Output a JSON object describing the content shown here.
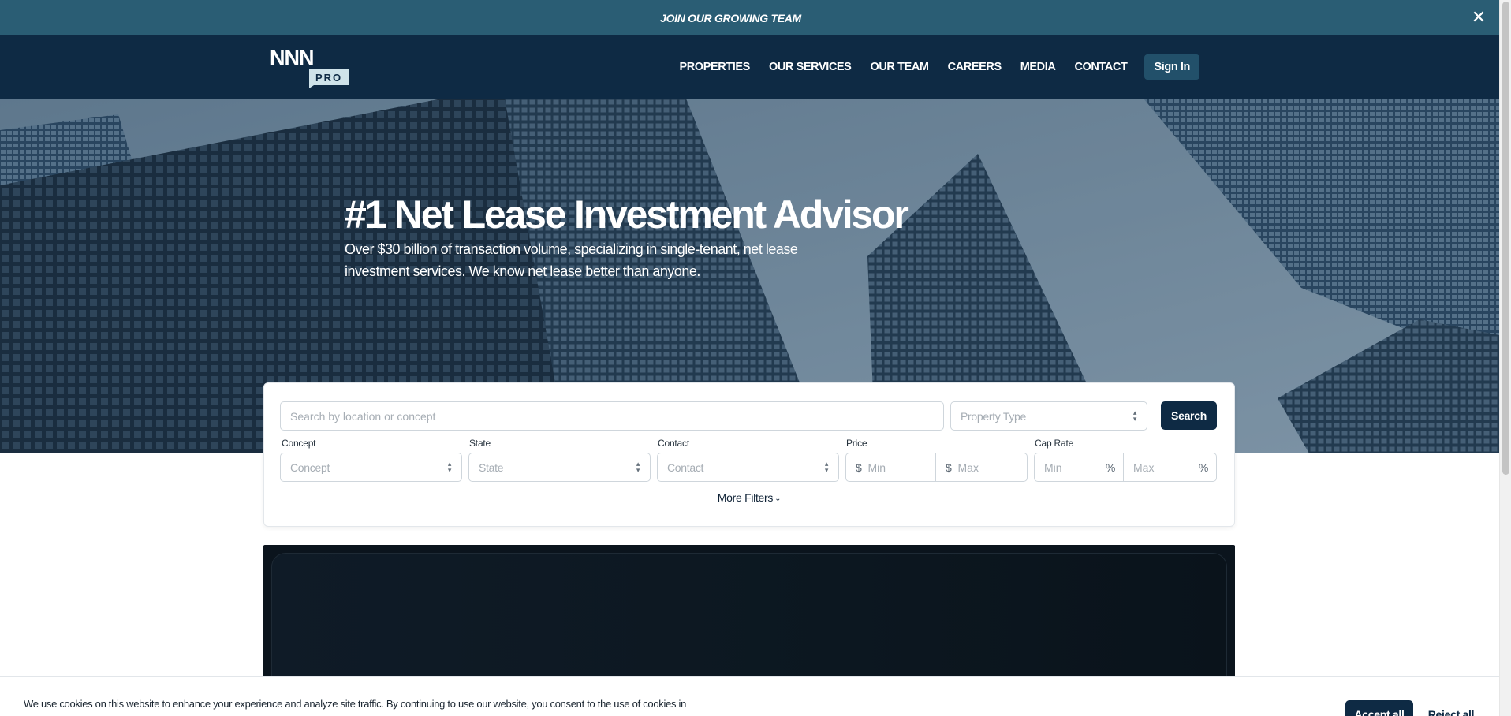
{
  "announcement": {
    "text": "JOIN OUR GROWING TEAM",
    "close_glyph": "✕"
  },
  "header": {
    "logo_text_top": "NNN",
    "logo_text_bottom": "PRO",
    "nav": [
      "PROPERTIES",
      "OUR SERVICES",
      "OUR TEAM",
      "CAREERS",
      "MEDIA",
      "CONTACT"
    ],
    "signin_label": "Sign In"
  },
  "hero": {
    "title": "#1 Net Lease Investment Advisor",
    "subtitle": "Over $30 billion of transaction volume, specializing in single-tenant, net lease investment services. We know net lease better than anyone."
  },
  "search": {
    "location_placeholder": "Search by location or concept",
    "property_type_placeholder": "Property Type",
    "search_label": "Search",
    "filters": {
      "concept_label": "Concept",
      "concept_placeholder": "Concept",
      "state_label": "State",
      "state_placeholder": "State",
      "contact_label": "Contact",
      "contact_placeholder": "Contact",
      "price_label": "Price",
      "currency_symbol": "$",
      "price_min_placeholder": "Min",
      "price_max_placeholder": "Max",
      "cap_rate_label": "Cap Rate",
      "percent_symbol": "%",
      "cap_min_placeholder": "Min",
      "cap_max_placeholder": "Max"
    },
    "more_filters_label": "More Filters"
  },
  "cookie": {
    "text": "We use cookies on this website to enhance your experience and analyze site traffic. By continuing to use our website, you consent to the use of cookies in",
    "accept_label": "Accept all",
    "reject_label": "Reject all"
  },
  "colors": {
    "announcement_bg": "#2a5d74",
    "header_bg": "#0e2a44",
    "primary_button": "#0e2a44",
    "signin_bg": "#22506a"
  }
}
